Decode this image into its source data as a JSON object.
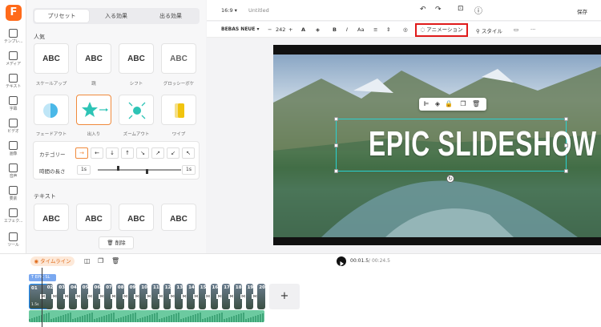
{
  "app": {
    "logo_letter": "F",
    "brand_color": "#ff6a1a"
  },
  "rail": [
    {
      "label": "テンプレ...",
      "icon": "template-icon"
    },
    {
      "label": "メディア",
      "icon": "media-icon"
    },
    {
      "label": "テキスト",
      "icon": "text-icon"
    },
    {
      "label": "字幕",
      "icon": "subtitle-icon"
    },
    {
      "label": "ビデオ",
      "icon": "video-icon"
    },
    {
      "label": "画像",
      "icon": "image-icon"
    },
    {
      "label": "音声",
      "icon": "audio-icon"
    },
    {
      "label": "要素",
      "icon": "elements-icon"
    },
    {
      "label": "エフェク...",
      "icon": "effects-icon"
    },
    {
      "label": "ツール",
      "icon": "tools-icon"
    }
  ],
  "panel": {
    "tabs": [
      "プリセット",
      "入る効果",
      "出る効果"
    ],
    "popular_title": "人気",
    "presets": [
      {
        "label": "スケールアップ",
        "thumb": "ABC"
      },
      {
        "label": "跳",
        "thumb": "ABC"
      },
      {
        "label": "シフト",
        "thumb": "ABC"
      },
      {
        "label": "グロッシーボケ",
        "thumb": "ABC"
      },
      {
        "label": "フェードアウト",
        "thumb": ""
      },
      {
        "label": "出入り",
        "thumb": ""
      },
      {
        "label": "ズームアウト",
        "thumb": ""
      },
      {
        "label": "ワイプ",
        "thumb": ""
      }
    ],
    "category_label": "カテゴリー",
    "directions": [
      "→",
      "←",
      "↓",
      "↑",
      "↘",
      "↗",
      "↙",
      "↖"
    ],
    "duration_label": "時間の長さ",
    "duration_start": "1s",
    "duration_end": "1s",
    "text_title": "テキスト",
    "text_presets": [
      "ABC",
      "ABC",
      "ABC",
      "ABC"
    ],
    "delete_label": "削除"
  },
  "topbar": {
    "ratio": "16:9",
    "title": "Untitled",
    "save_label": "保存"
  },
  "toolbar": {
    "font": "BEBAS NEUE",
    "size": "242",
    "minus": "−",
    "plus": "+",
    "animation_label": "アニメーション",
    "style_label": "スタイル",
    "more": "···"
  },
  "canvas": {
    "headline": "EPIC SLIDESHOW"
  },
  "timeline": {
    "tab_label": "タイムライン",
    "time_current": "00:01.5",
    "time_total": "00:24.5",
    "text_clip_label": "EPIC SL",
    "clip_numbers": [
      "01",
      "02",
      "03",
      "04",
      "05",
      "06",
      "07",
      "08",
      "09",
      "10",
      "11",
      "12",
      "13",
      "14",
      "15",
      "16",
      "17",
      "18",
      "19",
      "20"
    ],
    "selected_clip_duration": "1.5s",
    "add_label": "+"
  }
}
